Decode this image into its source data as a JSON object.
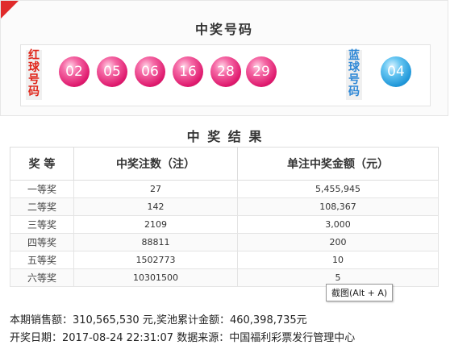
{
  "header": {
    "title": "中奖号码"
  },
  "red_label": [
    "红",
    "球",
    "号",
    "码"
  ],
  "blue_label": [
    "蓝",
    "球",
    "号",
    "码"
  ],
  "red_balls": [
    "02",
    "05",
    "06",
    "16",
    "28",
    "29"
  ],
  "blue_balls": [
    "04"
  ],
  "results": {
    "title": "中 奖 结 果",
    "columns": [
      "奖 等",
      "中奖注数（注）",
      "单注中奖金额（元）"
    ],
    "rows": [
      {
        "level": "一等奖",
        "count": "27",
        "amount": "5,455,945"
      },
      {
        "level": "二等奖",
        "count": "142",
        "amount": "108,367"
      },
      {
        "level": "三等奖",
        "count": "2109",
        "amount": "3,000"
      },
      {
        "level": "四等奖",
        "count": "88811",
        "amount": "200"
      },
      {
        "level": "五等奖",
        "count": "1502773",
        "amount": "10"
      },
      {
        "level": "六等奖",
        "count": "10301500",
        "amount": "5"
      }
    ]
  },
  "tooltip": "截图(Alt + A)",
  "info": {
    "sales": "本期销售额：310,565,530 元,奖池累计金额：460,398,735元",
    "draw": "开奖日期：2017-08-24 22:31:07 数据来源：中国福利彩票发行管理中心"
  },
  "colors": {
    "red_ball": "#df1a6e",
    "blue_ball": "#1e96d8",
    "corner": "#e02a2a"
  }
}
